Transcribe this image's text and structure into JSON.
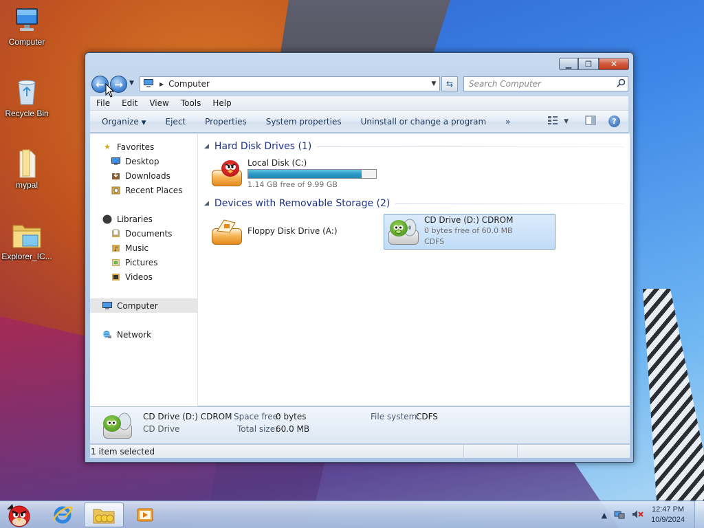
{
  "desktop": {
    "icons": [
      {
        "label": "Computer",
        "icon": "computer-icon"
      },
      {
        "label": "Recycle Bin",
        "icon": "recycle-bin-icon"
      },
      {
        "label": "mypal",
        "icon": "folder-icon"
      },
      {
        "label": "Explorer_IC...",
        "icon": "folder-icon"
      }
    ]
  },
  "window": {
    "address": {
      "location": "Computer"
    },
    "search": {
      "placeholder": "Search Computer"
    },
    "menu": [
      "File",
      "Edit",
      "View",
      "Tools",
      "Help"
    ],
    "commands": [
      "Organize",
      "Eject",
      "Properties",
      "System properties",
      "Uninstall or change a program",
      "»"
    ],
    "nav": {
      "favorites": {
        "label": "Favorites",
        "items": [
          "Desktop",
          "Downloads",
          "Recent Places"
        ]
      },
      "libraries": {
        "label": "Libraries",
        "items": [
          "Documents",
          "Music",
          "Pictures",
          "Videos"
        ]
      },
      "computer": "Computer",
      "network": "Network"
    },
    "groups": [
      {
        "title": "Hard Disk Drives (1)",
        "drives": [
          {
            "name": "Local Disk (C:)",
            "free_text": "1.14 GB free of 9.99 GB",
            "used_fraction": 0.886
          }
        ]
      },
      {
        "title": "Devices with Removable Storage (2)",
        "drives": [
          {
            "name": "Floppy Disk Drive (A:)"
          },
          {
            "name": "CD Drive (D:) CDROM",
            "free_text": "0 bytes free of 60.0 MB",
            "fs": "CDFS",
            "selected": true
          }
        ]
      }
    ],
    "details": {
      "name": "CD Drive (D:) CDROM",
      "type": "CD Drive",
      "space_free_label": "Space free:",
      "space_free": "0 bytes",
      "total_size_label": "Total size:",
      "total_size": "60.0 MB",
      "fs_label": "File system:",
      "fs": "CDFS"
    },
    "status": "1 item selected"
  },
  "taskbar": {
    "clock_time": "12:47 PM",
    "clock_date": "10/9/2024"
  },
  "colors": {
    "capacity_bar": "#2a9bc6",
    "group_header": "#1e3287"
  }
}
